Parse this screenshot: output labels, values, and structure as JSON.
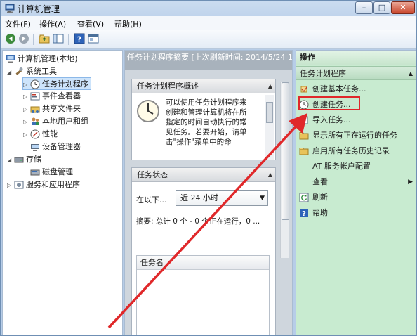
{
  "window": {
    "title": "计算机管理",
    "minimize": "–",
    "maximize": "□",
    "close": "✕"
  },
  "menu": [
    "文件(F)",
    "操作(A)",
    "查看(V)",
    "帮助(H)"
  ],
  "tree": {
    "root": "计算机管理(本地)",
    "system_tools": "系统工具",
    "task_scheduler": "任务计划程序",
    "event_viewer": "事件查看器",
    "shared_folders": "共享文件夹",
    "local_users": "本地用户和组",
    "performance": "性能",
    "device_manager": "设备管理器",
    "storage": "存储",
    "disk_management": "磁盘管理",
    "services": "服务和应用程序"
  },
  "middle": {
    "header": "任务计划程序摘要 [上次刷新时间: 2014/5/24 14",
    "overview_title": "任务计划程序概述",
    "overview_text_lines": [
      "可以使用任务计划程序来",
      "创建和管理计算机将在所",
      "指定的时间自动执行的常",
      "见任务。若要开始，请单",
      "击\"操作\"菜单中的命"
    ],
    "status_title": "任务状态",
    "status_label": "在以下...",
    "status_select": "近 24 小时",
    "summary": "摘要: 总计 0 个 - 0 个正在运行，0 ...",
    "task_name_header": "任务名"
  },
  "actions": {
    "header": "操作",
    "group": "任务计划程序",
    "items": [
      "创建基本任务...",
      "创建任务...",
      "导入任务...",
      "显示所有正在运行的任务",
      "启用所有任务历史记录",
      "AT 服务帐户配置",
      "查看",
      "刷新",
      "帮助"
    ]
  },
  "colors": {
    "highlight": "#e0282a",
    "actions_bg": "#c8ebd0"
  }
}
